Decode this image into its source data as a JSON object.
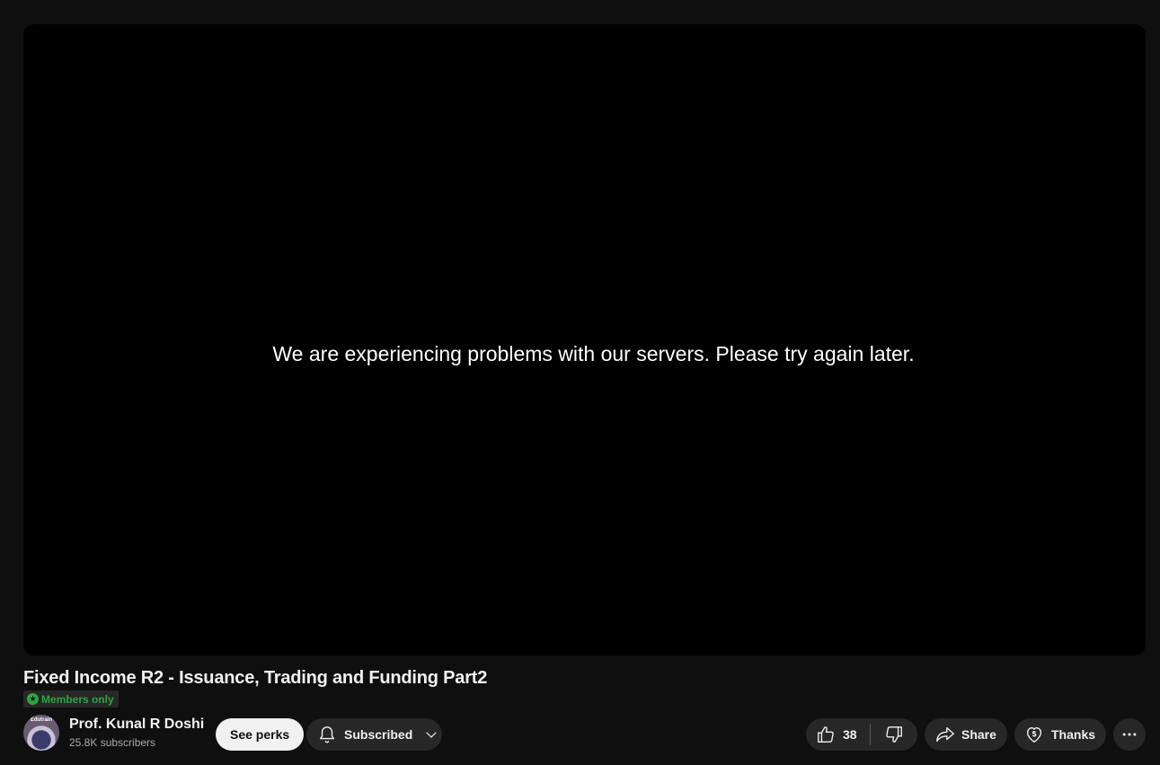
{
  "player": {
    "error_message": "We are experiencing problems with our servers. Please try again later."
  },
  "video": {
    "title": "Fixed Income R2 - Issuance, Trading and Funding Part2",
    "badge_label": "Members only"
  },
  "channel": {
    "avatar_text": "Edutrain",
    "name": "Prof. Kunal R Doshi",
    "subscribers": "25.8K subscribers"
  },
  "actions": {
    "see_perks_label": "See perks",
    "subscribed_label": "Subscribed",
    "like_count": "38",
    "share_label": "Share",
    "thanks_label": "Thanks"
  },
  "colors": {
    "background": "#0f0f0f",
    "player": "#000000",
    "pill": "#272727",
    "members_green": "#2ba640"
  }
}
